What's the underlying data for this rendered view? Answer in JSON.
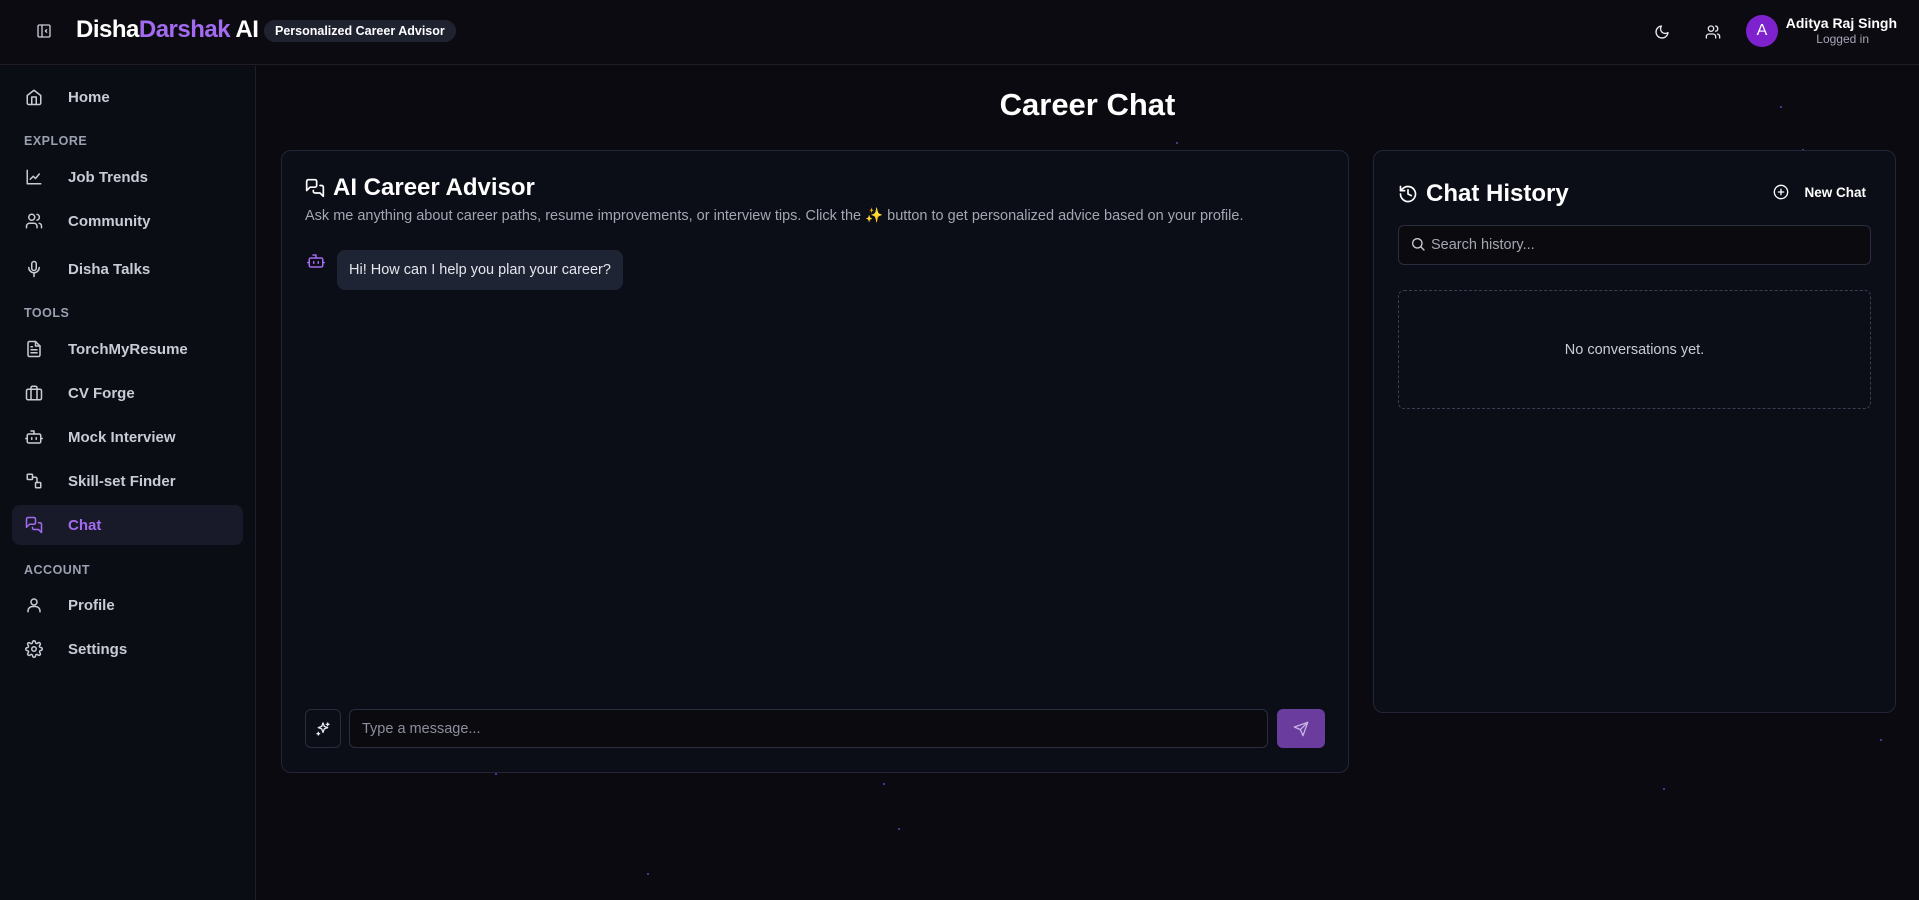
{
  "header": {
    "brand_part1": "Disha",
    "brand_part2": "Darshak",
    "brand_part3": " AI",
    "tagline": "Personalized Career Advisor",
    "icons": [
      "sidebar-toggle-icon",
      "moon-icon",
      "users-icon"
    ],
    "user": {
      "initial": "A",
      "name": "Aditya Raj Singh",
      "status": "Logged in"
    }
  },
  "sidebar": {
    "home": "Home",
    "sections": {
      "explore": "EXPLORE",
      "tools": "TOOLS",
      "account": "ACCOUNT"
    },
    "explore_items": [
      {
        "label": "Job Trends",
        "icon": "trend-icon"
      },
      {
        "label": "Community",
        "icon": "users-icon"
      },
      {
        "label": "Disha Talks",
        "icon": "mic-icon"
      }
    ],
    "tool_items": [
      {
        "label": "TorchMyResume",
        "icon": "document-icon"
      },
      {
        "label": "CV Forge",
        "icon": "briefcase-icon"
      },
      {
        "label": "Mock Interview",
        "icon": "bot-icon"
      },
      {
        "label": "Skill-set Finder",
        "icon": "shapes-icon"
      },
      {
        "label": "Chat",
        "icon": "chat-icon",
        "active": true
      }
    ],
    "account_items": [
      {
        "label": "Profile",
        "icon": "user-icon"
      },
      {
        "label": "Settings",
        "icon": "gear-icon"
      }
    ]
  },
  "main": {
    "page_title": "Career Chat",
    "chat": {
      "title": "AI Career Advisor",
      "subtitle": "Ask me anything about career paths, resume improvements, or interview tips. Click the ✨ button to get personalized advice based on your profile.",
      "messages": [
        {
          "sender": "bot",
          "text": "Hi! How can I help you plan your career?"
        }
      ],
      "input_placeholder": "Type a message..."
    },
    "history": {
      "title": "Chat History",
      "new_chat_label": "New Chat",
      "search_placeholder": "Search history...",
      "empty_text": "No conversations yet."
    }
  },
  "colors": {
    "accent": "#a36bf0",
    "send_button": "#6a3c9e",
    "avatar": "#7e22ce",
    "background": "#0b0a10"
  }
}
